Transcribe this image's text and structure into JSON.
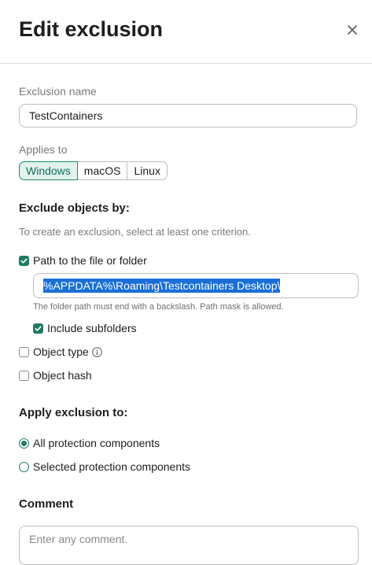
{
  "header": {
    "title": "Edit exclusion",
    "close_icon": "close-icon"
  },
  "exclusion_name": {
    "label": "Exclusion name",
    "value": "TestContainers"
  },
  "applies_to": {
    "label": "Applies to",
    "options": [
      "Windows",
      "macOS",
      "Linux"
    ],
    "selected": "Windows"
  },
  "exclude_objects": {
    "title": "Exclude objects by:",
    "hint": "To create an exclusion, select at least one criterion.",
    "path": {
      "label": "Path to the file or folder",
      "checked": true,
      "value": "%APPDATA%\\Roaming\\Testcontainers Desktop\\",
      "hint": "The folder path must end with a backslash. Path mask is allowed.",
      "include_subfolders_label": "Include subfolders",
      "include_subfolders_checked": true
    },
    "object_type": {
      "label": "Object type",
      "checked": false,
      "info_icon": "info-icon"
    },
    "object_hash": {
      "label": "Object hash",
      "checked": false
    }
  },
  "apply_to": {
    "title": "Apply exclusion to:",
    "options": [
      "All protection components",
      "Selected protection components"
    ],
    "selected": "All protection components"
  },
  "comment": {
    "title": "Comment",
    "placeholder": "Enter any comment."
  },
  "colors": {
    "accent": "#1f7a63",
    "selection": "#1a6fd6",
    "active_segment_bg": "#e2f3ee"
  }
}
